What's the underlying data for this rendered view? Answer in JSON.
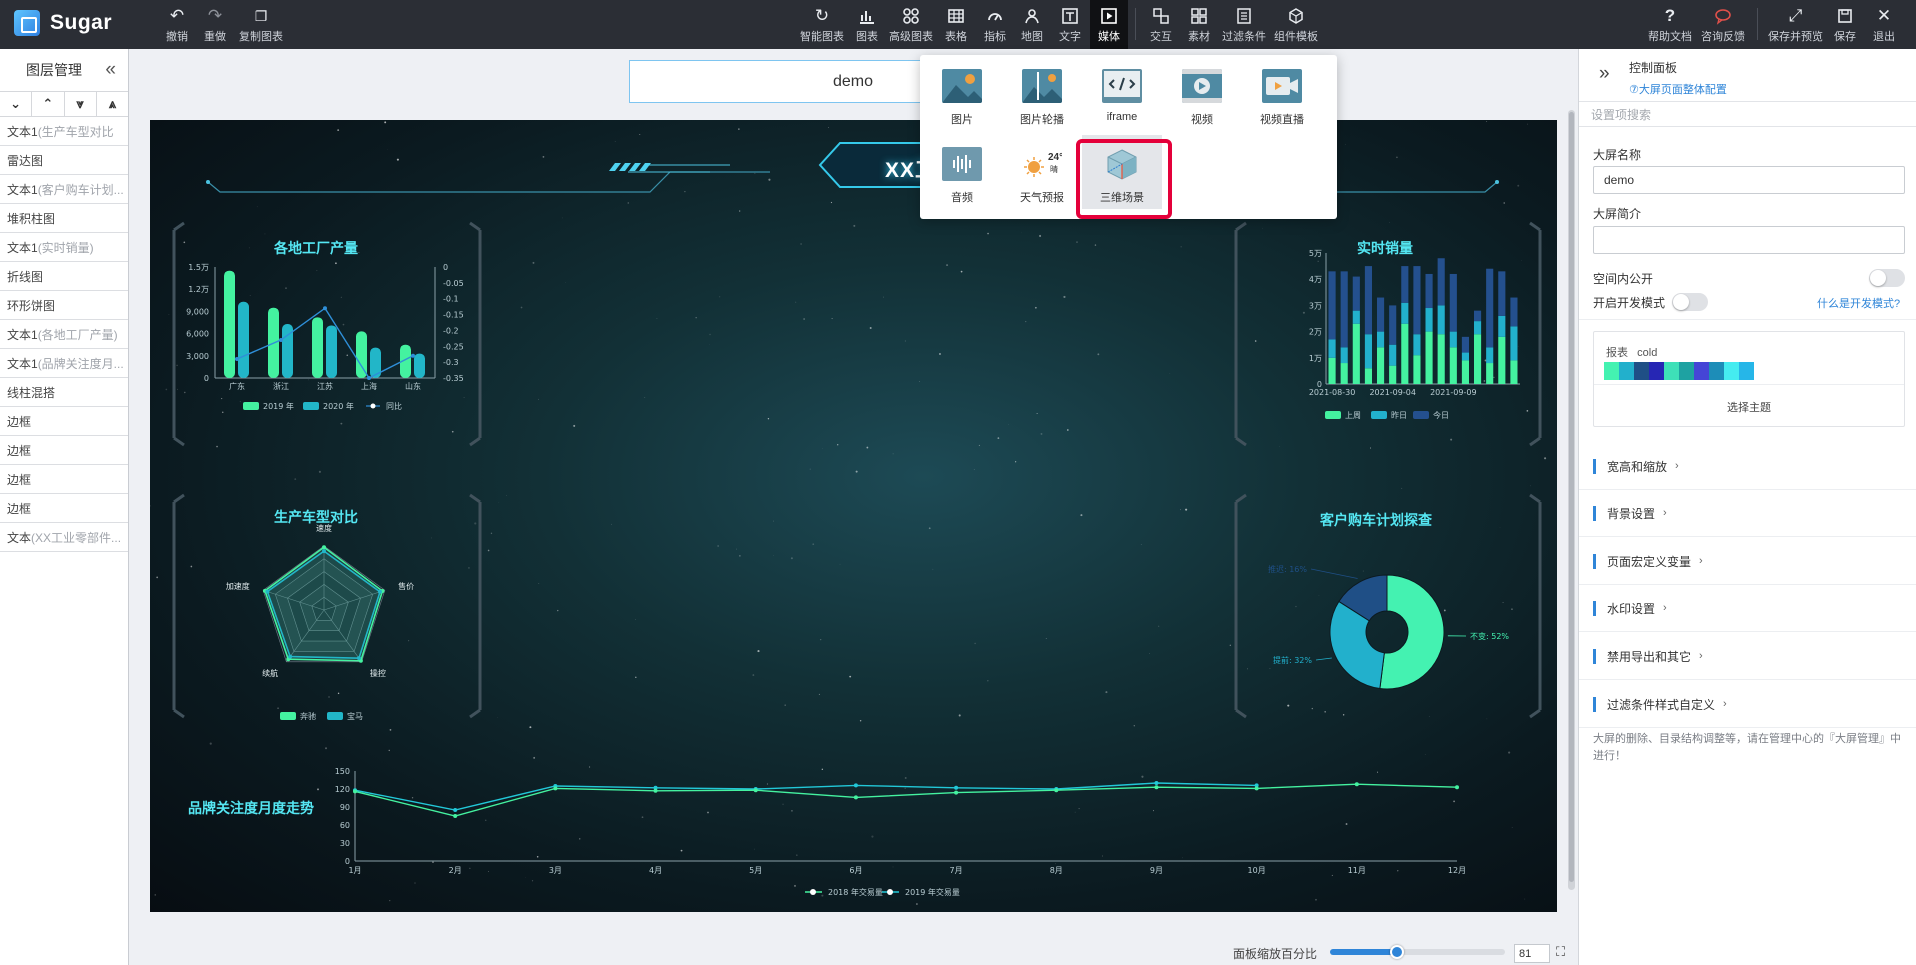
{
  "app": {
    "name": "Sugar"
  },
  "toolbar": {
    "left": [
      {
        "id": "undo",
        "label": "撤销",
        "icon": "undo-icon"
      },
      {
        "id": "redo",
        "label": "重做",
        "icon": "redo-icon"
      },
      {
        "id": "copy-chart",
        "label": "复制图表",
        "icon": "copy-icon"
      }
    ],
    "center": [
      {
        "id": "smart-chart",
        "label": "智能图表",
        "icon": "smart-chart-icon"
      },
      {
        "id": "chart",
        "label": "图表",
        "icon": "bar-chart-icon"
      },
      {
        "id": "advanced-chart",
        "label": "高级图表",
        "icon": "advanced-chart-icon"
      },
      {
        "id": "table",
        "label": "表格",
        "icon": "table-icon"
      },
      {
        "id": "indicator",
        "label": "指标",
        "icon": "gauge-icon"
      },
      {
        "id": "map",
        "label": "地图",
        "icon": "map-pin-icon"
      },
      {
        "id": "text",
        "label": "文字",
        "icon": "text-icon"
      },
      {
        "id": "media",
        "label": "媒体",
        "icon": "media-icon",
        "active": true
      },
      {
        "id": "interaction",
        "label": "交互",
        "icon": "interaction-icon"
      },
      {
        "id": "material",
        "label": "素材",
        "icon": "grid-icon"
      },
      {
        "id": "filter",
        "label": "过滤条件",
        "icon": "filter-icon"
      },
      {
        "id": "template",
        "label": "组件模板",
        "icon": "template-icon"
      }
    ],
    "right": [
      {
        "id": "help",
        "label": "帮助文档",
        "icon": "help-icon"
      },
      {
        "id": "feedback",
        "label": "咨询反馈",
        "icon": "chat-icon"
      },
      {
        "id": "save-preview",
        "label": "保存并预览",
        "icon": "expand-icon"
      },
      {
        "id": "save",
        "label": "保存",
        "icon": "save-icon"
      },
      {
        "id": "exit",
        "label": "退出",
        "icon": "close-icon"
      }
    ]
  },
  "layers": {
    "title": "图层管理",
    "items": [
      {
        "main": "文本1",
        "sub": "(生产车型对比"
      },
      {
        "main": "雷达图",
        "sub": ""
      },
      {
        "main": "文本1",
        "sub": "(客户购车计划..."
      },
      {
        "main": "堆积柱图",
        "sub": ""
      },
      {
        "main": "文本1",
        "sub": "(实时销量)"
      },
      {
        "main": "折线图",
        "sub": ""
      },
      {
        "main": "环形饼图",
        "sub": ""
      },
      {
        "main": "文本1",
        "sub": "(各地工厂产量)"
      },
      {
        "main": "文本1",
        "sub": "(品牌关注度月..."
      },
      {
        "main": "线柱混搭",
        "sub": ""
      },
      {
        "main": "边框",
        "sub": ""
      },
      {
        "main": "边框",
        "sub": ""
      },
      {
        "main": "边框",
        "sub": ""
      },
      {
        "main": "边框",
        "sub": ""
      },
      {
        "main": "文本",
        "sub": "(XX工业零部件..."
      }
    ]
  },
  "canvas": {
    "name_value": "demo",
    "title": "XX工业零部件工厂",
    "panels": {
      "factory": {
        "title": "各地工厂产量",
        "categories": [
          "广东",
          "浙江",
          "江苏",
          "上海",
          "山东"
        ],
        "y_ticks": [
          "1.5万",
          "1.2万",
          "9,000",
          "6,000",
          "3,000",
          "0"
        ],
        "y2_ticks": [
          "0",
          "-0.05",
          "-0.1",
          "-0.15",
          "-0.2",
          "-0.25",
          "-0.3",
          "-0.35"
        ],
        "series_2019": [
          14500,
          9500,
          8200,
          6300,
          4500
        ],
        "series_2020": [
          10300,
          7300,
          7100,
          4100,
          3300
        ],
        "ratio": [
          -0.29,
          -0.23,
          -0.13,
          -0.35,
          -0.28
        ],
        "legend": [
          "2019 年",
          "2020 年",
          "同比"
        ]
      },
      "realtime": {
        "title": "实时销量",
        "y_ticks": [
          "5万",
          "4万",
          "3万",
          "2万",
          "1万",
          "0"
        ],
        "x_ticks": [
          "2021-08-30",
          "2021-09-04",
          "2021-09-09"
        ],
        "legend": [
          "上周",
          "昨日",
          "今日"
        ],
        "last_week": [
          1.0,
          0.8,
          2.3,
          0.6,
          1.4,
          0.7,
          2.3,
          1.1,
          2.0,
          1.9,
          1.4,
          0.9,
          1.9,
          0.8,
          1.8,
          0.9
        ],
        "yesterday": [
          0.7,
          0.6,
          0.5,
          1.3,
          0.6,
          0.8,
          0.8,
          0.8,
          0.9,
          1.1,
          0.6,
          0.3,
          0.5,
          0.6,
          0.8,
          1.3
        ],
        "today": [
          2.6,
          2.9,
          1.3,
          2.6,
          1.3,
          1.5,
          1.4,
          2.6,
          1.3,
          1.8,
          2.2,
          0.6,
          0.4,
          3.0,
          1.7,
          1.1
        ]
      },
      "radar": {
        "title": "生产车型对比",
        "indicators": [
          "速度",
          "售价",
          "操控",
          "续航",
          "加速度"
        ],
        "legend": [
          "奔驰",
          "宝马"
        ],
        "benz": [
          0.98,
          0.96,
          0.98,
          0.95,
          0.97
        ],
        "bmw": [
          0.92,
          0.92,
          0.93,
          0.9,
          0.93
        ]
      },
      "donut": {
        "title": "客户购车计划探查",
        "slices": [
          {
            "label": "不变: 52%",
            "value": 52,
            "color": "#44f2b1"
          },
          {
            "label": "提前: 32%",
            "value": 32,
            "color": "#22b0cc"
          },
          {
            "label": "推迟: 16%",
            "value": 16,
            "color": "#1f4f86"
          }
        ]
      },
      "trend": {
        "title": "品牌关注度月度走势",
        "x": [
          "1月",
          "2月",
          "3月",
          "4月",
          "5月",
          "6月",
          "7月",
          "8月",
          "9月",
          "10月",
          "11月",
          "12月"
        ],
        "y_ticks": [
          "150",
          "120",
          "90",
          "60",
          "30",
          "0"
        ],
        "series_2018": [
          116,
          75,
          121,
          117,
          118,
          106,
          114,
          118,
          123,
          121,
          128,
          123
        ],
        "series_2019": [
          118,
          85,
          125,
          122,
          120,
          126,
          122,
          120,
          130,
          126
        ],
        "legend": [
          "2018 年交易量",
          "2019 年交易量"
        ]
      }
    }
  },
  "media_menu": {
    "items": [
      {
        "label": "图片",
        "icon": "image-icon"
      },
      {
        "label": "图片轮播",
        "icon": "carousel-icon"
      },
      {
        "label": "iframe",
        "icon": "code-icon"
      },
      {
        "label": "视频",
        "icon": "video-icon"
      },
      {
        "label": "视频直播",
        "icon": "live-video-icon"
      },
      {
        "label": "音频",
        "icon": "audio-icon"
      },
      {
        "label": "天气预报",
        "icon": "weather-icon",
        "temp": "24°",
        "desc": "晴"
      },
      {
        "label": "三维场景",
        "icon": "cube-icon",
        "selected": true
      }
    ]
  },
  "control_panel": {
    "title": "控制面板",
    "link": "⑦大屏页面整体配置",
    "search_placeholder": "设置项搜索",
    "screen_name_label": "大屏名称",
    "screen_name_value": "demo",
    "intro_label": "大屏简介",
    "intro_value": "",
    "public_label": "空间内公开",
    "dev_label": "开启开发模式",
    "dev_link": "什么是开发模式?",
    "theme_label": "报表",
    "theme_name": "cold",
    "theme_colors": [
      "#44f2b1",
      "#22b0cc",
      "#1f4f86",
      "#2626b4",
      "#3ee0b8",
      "#1ea2a2",
      "#4545d6",
      "#1d8db8",
      "#45ecf0",
      "#26b6e8"
    ],
    "choose_theme": "选择主题",
    "sections": [
      "宽高和缩放",
      "背景设置",
      "页面宏定义变量",
      "水印设置",
      "禁用导出和其它",
      "过滤条件样式自定义"
    ],
    "note": "大屏的删除、目录结构调整等，请在管理中心的『大屏管理』中进行！"
  },
  "zoom": {
    "label": "面板缩放百分比",
    "value": "81",
    "percent": 0.38
  }
}
